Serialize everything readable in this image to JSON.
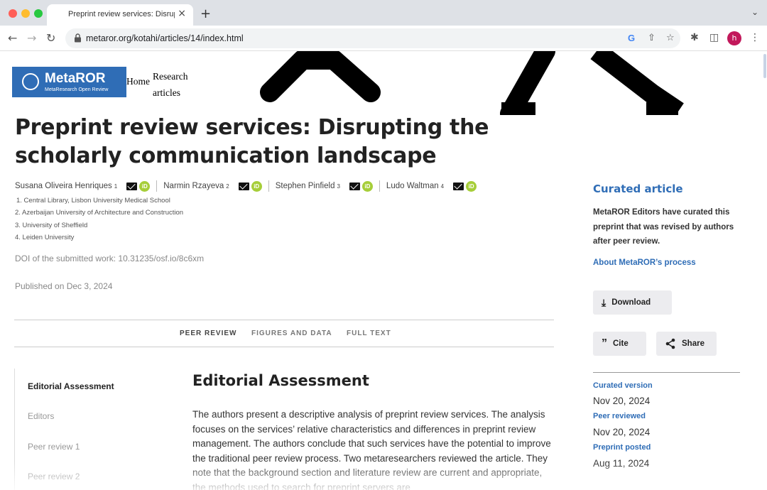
{
  "browser": {
    "tab_title": "Preprint review services: Disrupting the scholarly communication landscape",
    "tab_close": "×",
    "new_tab": "+",
    "url": "metaror.org/kotahi/articles/14/index.html",
    "avatar_letter": "h",
    "icons": [
      "back-icon",
      "forward-icon",
      "reload-icon",
      "lock-icon",
      "google-icon",
      "share-icon",
      "star-icon",
      "extensions-icon",
      "sidebar-icon",
      "menu-icon"
    ]
  },
  "site": {
    "logo_title": "MetaROR",
    "logo_subtitle": "MetaResearch Open Review",
    "nav": {
      "home": "Home",
      "research_articles": "Research articles"
    }
  },
  "article": {
    "title": "Preprint review services: Disrupting the scholarly communication landscape",
    "authors": [
      {
        "name": "Susana Oliveira Henriques",
        "affil": "1"
      },
      {
        "name": "Narmin Rzayeva",
        "affil": "2"
      },
      {
        "name": "Stephen Pinfield",
        "affil": "3"
      },
      {
        "name": "Ludo Waltman",
        "affil": "4"
      }
    ],
    "orcid_label": "iD",
    "affiliations": [
      "1. Central Library, Lisbon University Medical School",
      "2. Azerbaijan University of Architecture and Construction",
      "3. University of Sheffield",
      "4. Leiden University"
    ],
    "doi": "DOI of the submitted work: 10.31235/osf.io/8c6xm",
    "published": "Published on Dec 3, 2024"
  },
  "page_tabs": [
    "PEER REVIEW",
    "FIGURES AND DATA",
    "FULL TEXT"
  ],
  "toc": [
    "Editorial Assessment",
    "Editors",
    "Peer review 1",
    "Peer review 2"
  ],
  "section": {
    "heading": "Editorial Assessment",
    "text": "The authors present a descriptive analysis of preprint review services. The analysis focuses on the services’ relative characteristics and differences in preprint review management. The authors conclude that such services have the potential to improve the traditional peer review process. Two metaresearchers reviewed the article. They note that the background section and literature review are current and appropriate, the methods used to search for preprint servers are"
  },
  "sidebar": {
    "heading": "Curated article",
    "description": "MetaROR Editors have curated this preprint that was revised by authors after peer review.",
    "process_link": "About MetaROR’s process",
    "download": "Download",
    "cite": "Cite",
    "share": "Share",
    "versions": [
      {
        "label": "Curated version",
        "date": "Nov 20, 2024"
      },
      {
        "label": "Peer reviewed",
        "date": "Nov 20, 2024"
      },
      {
        "label": "Preprint posted",
        "date": "Aug 11, 2024"
      }
    ]
  },
  "colors": {
    "brand": "#2f6db6",
    "orcid": "#a6ce39",
    "active_tab": "#444444",
    "muted_tab": "#777777"
  }
}
